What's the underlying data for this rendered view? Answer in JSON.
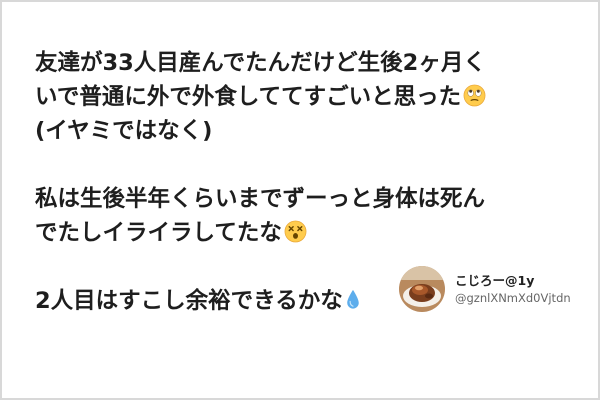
{
  "post": {
    "line1": "友達が33人目産んでたんだけど生後2ヶ月く",
    "line2": "いで普通に外で外食しててすごいと思った",
    "line2_emoji": "eye-roll-emoji",
    "line3": "(イヤミではなく)",
    "line4": "私は生後半年くらいまでずーっと身体は死ん",
    "line5": "でたしイライラしてたな",
    "line5_emoji": "dizzy-face-emoji",
    "line6": "2人目はすこし余裕できるかな",
    "line6_emoji": "droplet-emoji"
  },
  "profile": {
    "display_name": "こじろー@1y",
    "handle": "@gznlXNmXd0Vjtdn",
    "avatar": "dessert-photo-avatar"
  },
  "colors": {
    "text": "#1e1e1e",
    "frame_border": "#d8d8d8",
    "handle_text": "#666666"
  }
}
